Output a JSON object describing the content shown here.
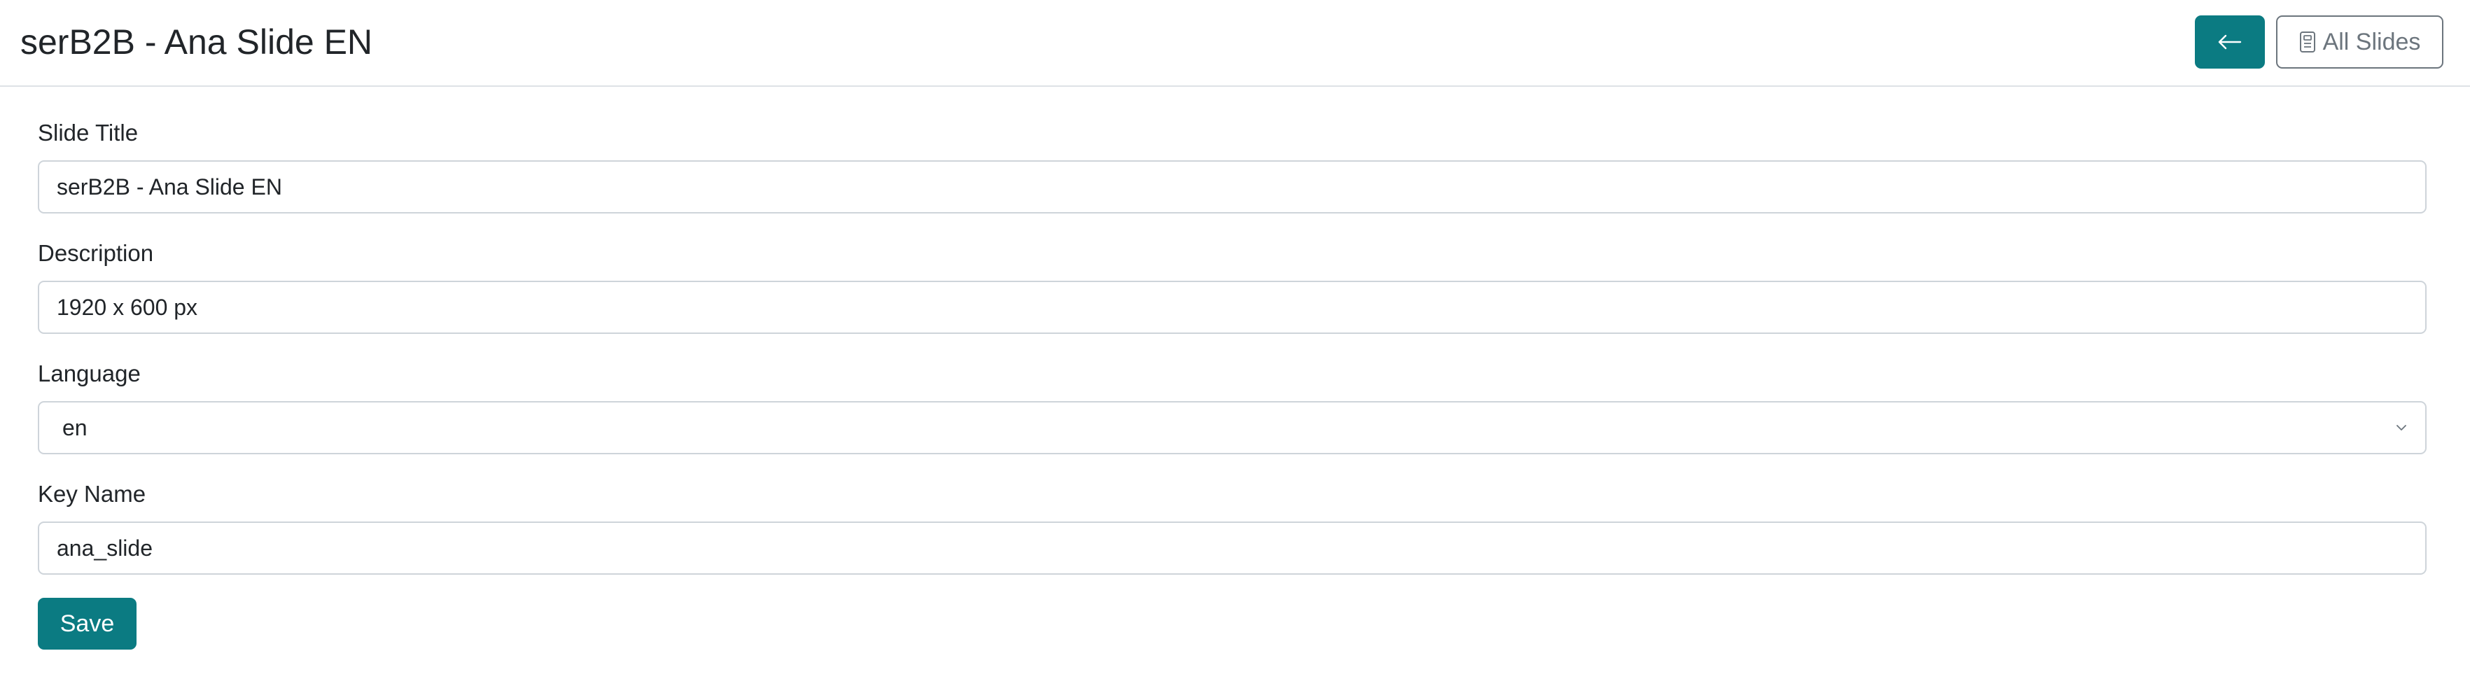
{
  "header": {
    "title": "serB2B - Ana Slide EN",
    "back_icon": "arrow-left-icon",
    "all_slides_icon": "slides-document-icon",
    "all_slides_label": "All Slides"
  },
  "form": {
    "slide_title": {
      "label": "Slide Title",
      "value": "serB2B - Ana Slide EN"
    },
    "description": {
      "label": "Description",
      "value": "1920 x 600 px"
    },
    "language": {
      "label": "Language",
      "value": "en",
      "icon": "chevron-down-icon"
    },
    "key_name": {
      "label": "Key Name",
      "value": "ana_slide"
    },
    "save_label": "Save"
  },
  "colors": {
    "primary": "#0b7b82",
    "secondary": "#6c757d",
    "border": "#ced4da",
    "text": "#212529"
  }
}
